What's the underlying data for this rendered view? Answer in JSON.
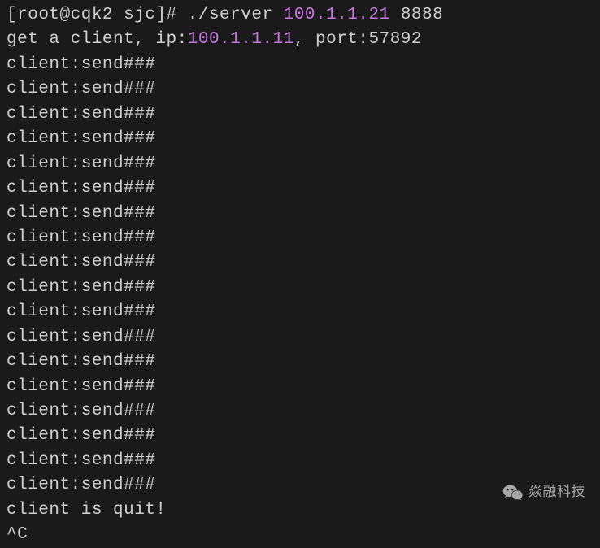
{
  "prompt": {
    "open_bracket": "[",
    "user_host": "root@cqk2 sjc",
    "close_bracket": "]# ",
    "command": "./server ",
    "ip_arg": "100.1.1.21",
    "space": " ",
    "port_arg": "8888"
  },
  "client_info": {
    "prefix": "get a client, ip:",
    "ip": "100.1.1.11",
    "suffix": ", port:57892"
  },
  "send_lines": [
    "client:send###",
    "client:send###",
    "client:send###",
    "client:send###",
    "client:send###",
    "client:send###",
    "client:send###",
    "client:send###",
    "client:send###",
    "client:send###",
    "client:send###",
    "client:send###",
    "client:send###",
    "client:send###",
    "client:send###",
    "client:send###",
    "client:send###",
    "client:send###"
  ],
  "quit_line": "client is quit!",
  "interrupt": "^C",
  "watermark": {
    "text": "焱融科技"
  }
}
